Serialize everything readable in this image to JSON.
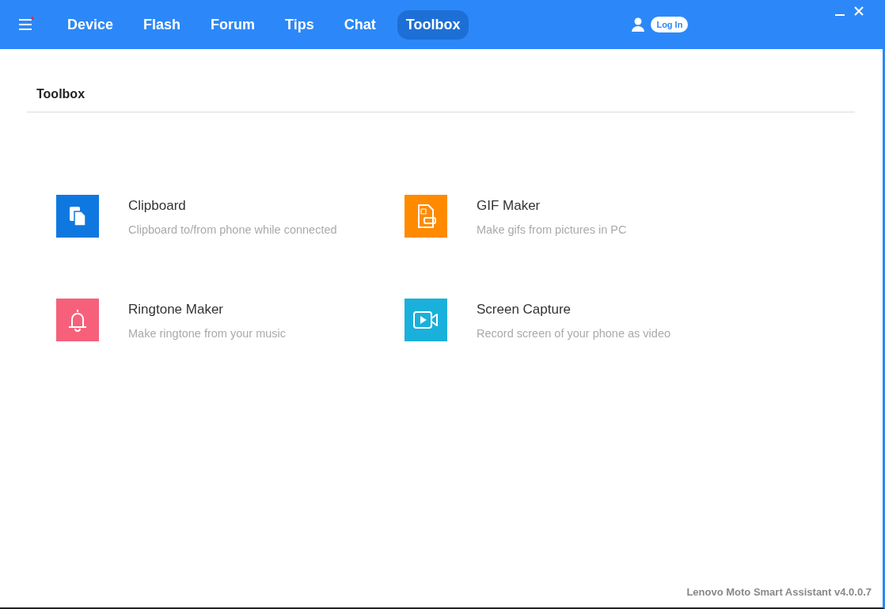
{
  "nav": {
    "notification_dot": true,
    "tabs": [
      {
        "label": "Device",
        "selected": false
      },
      {
        "label": "Flash",
        "selected": false
      },
      {
        "label": "Forum",
        "selected": false
      },
      {
        "label": "Tips",
        "selected": false
      },
      {
        "label": "Chat",
        "selected": false
      },
      {
        "label": "Toolbox",
        "selected": true
      }
    ],
    "login": "Log In"
  },
  "page": {
    "title": "Toolbox",
    "tools": [
      {
        "kind": "clipboard",
        "name": "Clipboard",
        "description": "Clipboard to/from phone while connected",
        "color": "#0f78e0"
      },
      {
        "kind": "gif",
        "name": "GIF Maker",
        "description": "Make gifs from pictures in PC",
        "color": "#ff8a00"
      },
      {
        "kind": "bell",
        "name": "Ringtone Maker",
        "description": "Make ringtone from your music",
        "color": "#f7607a"
      },
      {
        "kind": "video",
        "name": "Screen Capture",
        "description": "Record screen of your phone as video",
        "color": "#1ab0dc"
      }
    ]
  },
  "footer": {
    "version": "Lenovo Moto Smart Assistant v4.0.0.7"
  }
}
